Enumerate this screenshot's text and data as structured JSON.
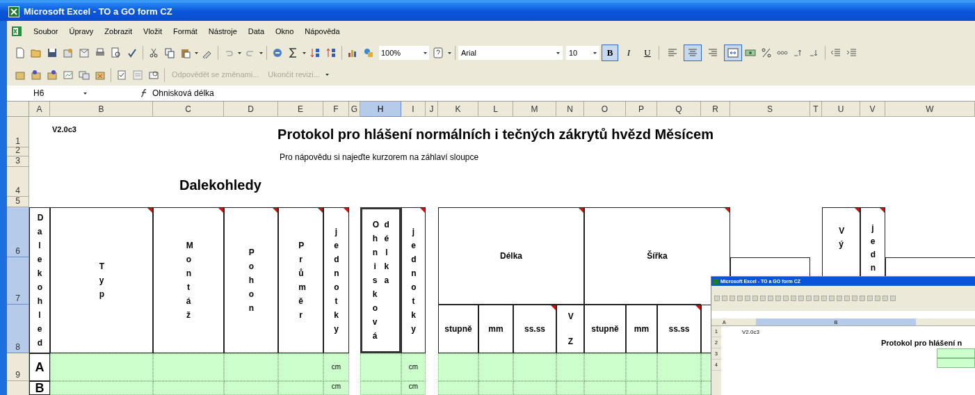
{
  "window": {
    "title": "Microsoft Excel - TO a GO form CZ"
  },
  "menu": [
    "Soubor",
    "Úpravy",
    "Zobrazit",
    "Vložit",
    "Formát",
    "Nástroje",
    "Data",
    "Okno",
    "Nápověda"
  ],
  "toolbar": {
    "zoom": "100%",
    "font": "Arial",
    "font_size": "10",
    "format_buttons": [
      {
        "label": "B",
        "kind": "bold",
        "pressed": true
      },
      {
        "label": "I",
        "kind": "italic",
        "pressed": false
      },
      {
        "label": "U",
        "kind": "underline",
        "pressed": false
      }
    ],
    "align_buttons": [
      {
        "kind": "left",
        "pressed": false
      },
      {
        "kind": "center",
        "pressed": true
      },
      {
        "kind": "right",
        "pressed": false
      },
      {
        "kind": "merge",
        "pressed": true
      }
    ]
  },
  "review_toolbar": [
    {
      "label": "Odpovědět se změnami...",
      "disabled": true
    },
    {
      "label": "Ukončit revizi...",
      "disabled": true
    }
  ],
  "formula_bar": {
    "name_box": "H6",
    "formula": "Ohnisková délka"
  },
  "columns": [
    {
      "label": "A",
      "selected": false
    },
    {
      "label": "B",
      "selected": false
    },
    {
      "label": "C",
      "selected": false
    },
    {
      "label": "D",
      "selected": false
    },
    {
      "label": "E",
      "selected": false
    },
    {
      "label": "F",
      "selected": false
    },
    {
      "label": "G",
      "selected": false
    },
    {
      "label": "H",
      "selected": true
    },
    {
      "label": "I",
      "selected": false
    },
    {
      "label": "J",
      "selected": false
    },
    {
      "label": "K",
      "selected": false
    },
    {
      "label": "L",
      "selected": false
    },
    {
      "label": "M",
      "selected": false
    },
    {
      "label": "N",
      "selected": false
    },
    {
      "label": "O",
      "selected": false
    },
    {
      "label": "P",
      "selected": false
    },
    {
      "label": "Q",
      "selected": false
    },
    {
      "label": "R",
      "selected": false
    },
    {
      "label": "S",
      "selected": false
    },
    {
      "label": "T",
      "selected": false
    },
    {
      "label": "U",
      "selected": false
    },
    {
      "label": "V",
      "selected": false
    },
    {
      "label": "W",
      "selected": false
    }
  ],
  "rows": [
    {
      "label": "1",
      "selected": false
    },
    {
      "label": "2",
      "selected": false
    },
    {
      "label": "3",
      "selected": false
    },
    {
      "label": "4",
      "selected": false
    },
    {
      "label": "5",
      "selected": false
    },
    {
      "label": "6",
      "selected": true
    },
    {
      "label": "7",
      "selected": true
    },
    {
      "label": "8",
      "selected": true
    },
    {
      "label": "9",
      "selected": false
    }
  ],
  "cells": [
    {
      "kind": "version",
      "text": "V2.0c3"
    },
    {
      "kind": "title",
      "text": "Protokol pro hlášení normálních i tečných zákrytů hvězd Měsícem"
    },
    {
      "kind": "subtitle",
      "text": "Pro nápovědu si najeďte kurzorem na záhlaví sloupce"
    },
    {
      "kind": "section",
      "text": "Dalekohledy"
    },
    {
      "kind": "vheader",
      "text": "Dalekohled",
      "comment": false,
      "selected": false
    },
    {
      "kind": "vheader",
      "text": "Typ",
      "comment": true,
      "selected": false
    },
    {
      "kind": "vheader",
      "text": "Montáž",
      "comment": true,
      "selected": false
    },
    {
      "kind": "vheader",
      "text": "Pohon",
      "comment": true,
      "selected": false
    },
    {
      "kind": "vheader",
      "text": "Průměr",
      "comment": true,
      "selected": false
    },
    {
      "kind": "vheader",
      "text": "jednotky",
      "comment": true,
      "selected": false
    },
    {
      "kind": "vheader",
      "text": "Ohnisková délka",
      "comment": false,
      "selected": true
    },
    {
      "kind": "vheader",
      "text": "jednotky",
      "comment": true,
      "selected": false
    },
    {
      "kind": "header",
      "text": "Délka",
      "comment": true,
      "selected": false
    },
    {
      "kind": "header",
      "text": "Šířka",
      "comment": true,
      "selected": false
    },
    {
      "kind": "header",
      "text": "stupně",
      "comment": false,
      "selected": false
    },
    {
      "kind": "header",
      "text": "mm",
      "comment": false,
      "selected": false
    },
    {
      "kind": "header",
      "text": "ss.ss",
      "comment": true,
      "selected": false
    },
    {
      "kind": "vheader",
      "text": "VZ",
      "comment": false,
      "selected": false
    },
    {
      "kind": "header",
      "text": "stupně",
      "comment": false,
      "selected": false
    },
    {
      "kind": "header",
      "text": "mm",
      "comment": false,
      "selected": false
    },
    {
      "kind": "header",
      "text": "ss.ss",
      "comment": true,
      "selected": false
    },
    {
      "kind": "vheader",
      "text": "Vý",
      "comment": true,
      "selected": false
    },
    {
      "kind": "vheader",
      "text": "jedn",
      "comment": true,
      "selected": false
    }
  ],
  "data_rows": [
    {
      "label": "A",
      "unit_1": "cm",
      "unit_2": "cm"
    },
    {
      "label": "B",
      "unit_1": "cm",
      "unit_2": "cm"
    }
  ],
  "inset": {
    "title": "Microsoft Excel - TO a GO form CZ",
    "columns": [
      "A",
      "B"
    ],
    "rows": [
      "1",
      "2",
      "3",
      "4"
    ],
    "version": "V2.0c3",
    "heading": "Protokol pro hlášení n"
  }
}
